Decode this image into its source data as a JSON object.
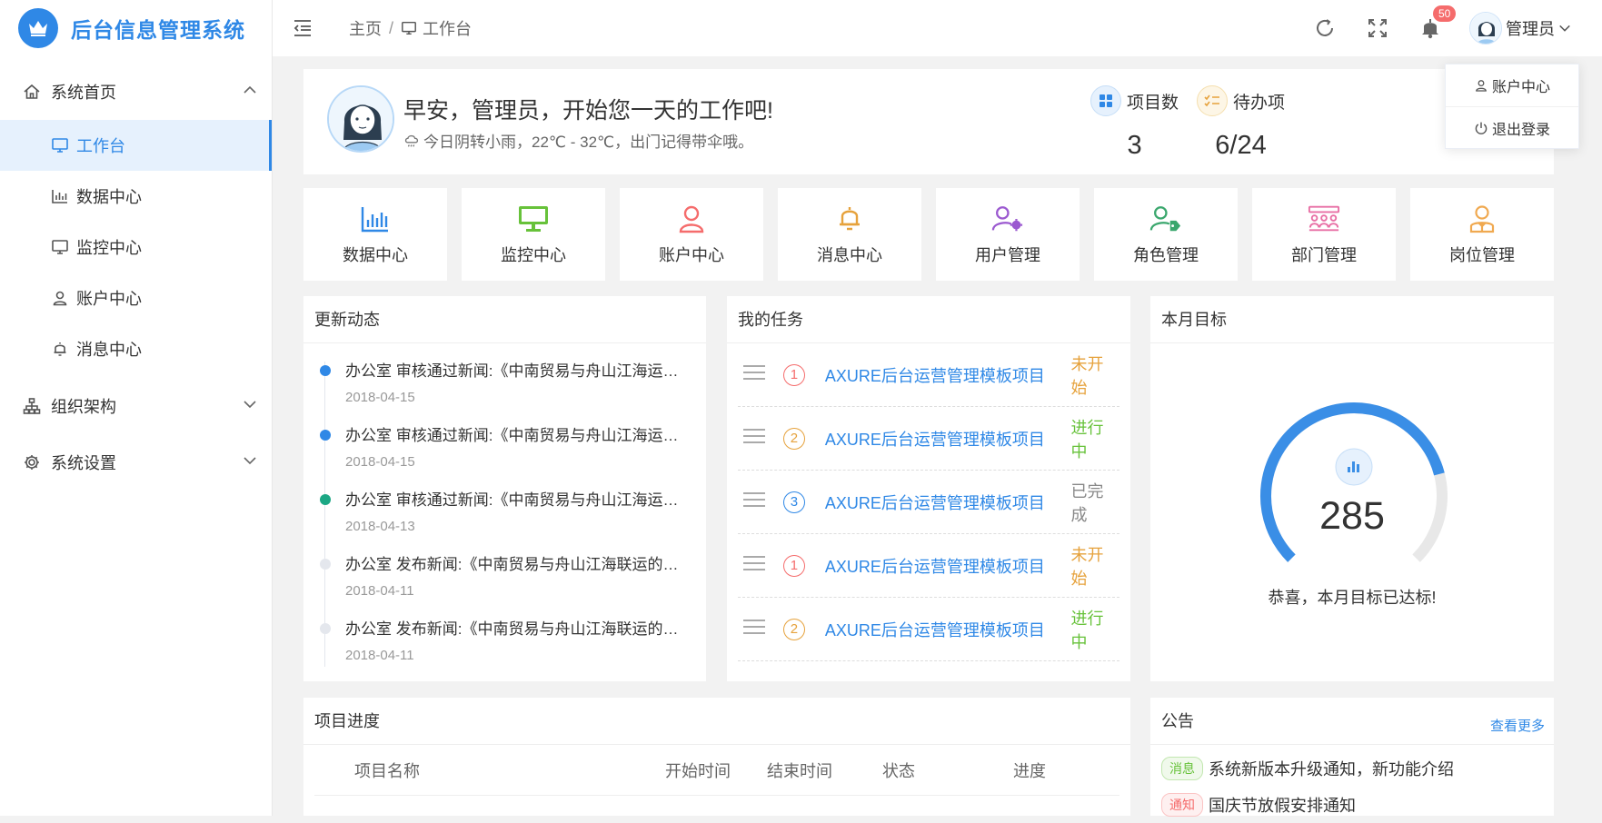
{
  "app": {
    "title": "后台信息管理系统"
  },
  "sidebar": {
    "groups": [
      {
        "label": "系统首页",
        "icon": "home-icon",
        "expanded": true
      },
      {
        "label": "组织架构",
        "icon": "org-chart-icon",
        "expanded": false
      },
      {
        "label": "系统设置",
        "icon": "gear-icon",
        "expanded": false
      }
    ],
    "items": [
      {
        "label": "工作台",
        "icon": "monitor-icon",
        "active": true
      },
      {
        "label": "数据中心",
        "icon": "bar-chart-icon"
      },
      {
        "label": "监控中心",
        "icon": "monitor-icon"
      },
      {
        "label": "账户中心",
        "icon": "user-icon"
      },
      {
        "label": "消息中心",
        "icon": "bell-icon"
      }
    ]
  },
  "header": {
    "breadcrumb": {
      "home": "主页",
      "separator": "/",
      "current": "工作台"
    },
    "notification_count": "50",
    "user_name": "管理员",
    "dropdown": {
      "account": "账户中心",
      "logout": "退出登录"
    }
  },
  "welcome": {
    "greeting": "早安，管理员，开始您一天的工作吧!",
    "weather": "今日阴转小雨，22℃ - 32℃，出门记得带伞哦。",
    "stats": [
      {
        "label": "项目数",
        "value": "3",
        "icon": "grid-icon",
        "color": "#2f88e6"
      },
      {
        "label": "待办项",
        "value": "6/24",
        "icon": "checklist-icon",
        "color": "#e6a23c"
      }
    ]
  },
  "quick_links": [
    {
      "label": "数据中心",
      "icon": "bar-chart-icon",
      "color": "#2f88e6"
    },
    {
      "label": "监控中心",
      "icon": "monitor-icon",
      "color": "#67c23a"
    },
    {
      "label": "账户中心",
      "icon": "user-icon",
      "color": "#f56c6c"
    },
    {
      "label": "消息中心",
      "icon": "bell-icon",
      "color": "#e6a23c"
    },
    {
      "label": "用户管理",
      "icon": "user-gear-icon",
      "color": "#9b59d0"
    },
    {
      "label": "角色管理",
      "icon": "user-tag-icon",
      "color": "#3aa76d"
    },
    {
      "label": "部门管理",
      "icon": "department-icon",
      "color": "#e86fa5"
    },
    {
      "label": "岗位管理",
      "icon": "position-icon",
      "color": "#f0a950"
    }
  ],
  "updates": {
    "title": "更新动态",
    "items": [
      {
        "text": "办公室 审核通过新闻:《中南贸易与舟山江海运联运有限公司签约》",
        "date": "2018-04-15",
        "color": "#2f88e6"
      },
      {
        "text": "办公室 审核通过新闻:《中南贸易与舟山江海运联运有限公司签约》",
        "date": "2018-04-15",
        "color": "#2f88e6"
      },
      {
        "text": "办公室 审核通过新闻:《中南贸易与舟山江海运联运有限公司签约》",
        "date": "2018-04-13",
        "color": "#1ba784"
      },
      {
        "text": "办公室 发布新闻:《中南贸易与舟山江海联运的合作签约仪式》",
        "date": "2018-04-11",
        "color": "#e4e7ed"
      },
      {
        "text": "办公室 发布新闻:《中南贸易与舟山江海联运的合作签约仪式》",
        "date": "2018-04-11",
        "color": "#e4e7ed"
      }
    ]
  },
  "tasks": {
    "title": "我的任务",
    "items": [
      {
        "num": "1",
        "name": "AXURE后台运营管理模板项目",
        "status": "未开始",
        "num_color": "#f56c6c",
        "status_color": "#e6a23c"
      },
      {
        "num": "2",
        "name": "AXURE后台运营管理模板项目",
        "status": "进行中",
        "num_color": "#e6a23c",
        "status_color": "#67c23a"
      },
      {
        "num": "3",
        "name": "AXURE后台运营管理模板项目",
        "status": "已完成",
        "num_color": "#2f88e6",
        "status_color": "#888888"
      },
      {
        "num": "1",
        "name": "AXURE后台运营管理模板项目",
        "status": "未开始",
        "num_color": "#f56c6c",
        "status_color": "#e6a23c"
      },
      {
        "num": "2",
        "name": "AXURE后台运营管理模板项目",
        "status": "进行中",
        "num_color": "#e6a23c",
        "status_color": "#67c23a"
      }
    ]
  },
  "goal": {
    "title": "本月目标",
    "value": "285",
    "message": "恭喜，本月目标已达标!",
    "progress": 0.78
  },
  "progress": {
    "title": "项目进度",
    "columns": [
      "项目名称",
      "开始时间",
      "结束时间",
      "状态",
      "进度"
    ]
  },
  "notices": {
    "title": "公告",
    "more": "查看更多",
    "items": [
      {
        "tag": "消息",
        "text": "系统新版本升级通知，新功能介绍",
        "tag_color": "#67c23a"
      },
      {
        "tag": "通知",
        "text": "国庆节放假安排通知",
        "tag_color": "#f56c6c"
      }
    ]
  }
}
